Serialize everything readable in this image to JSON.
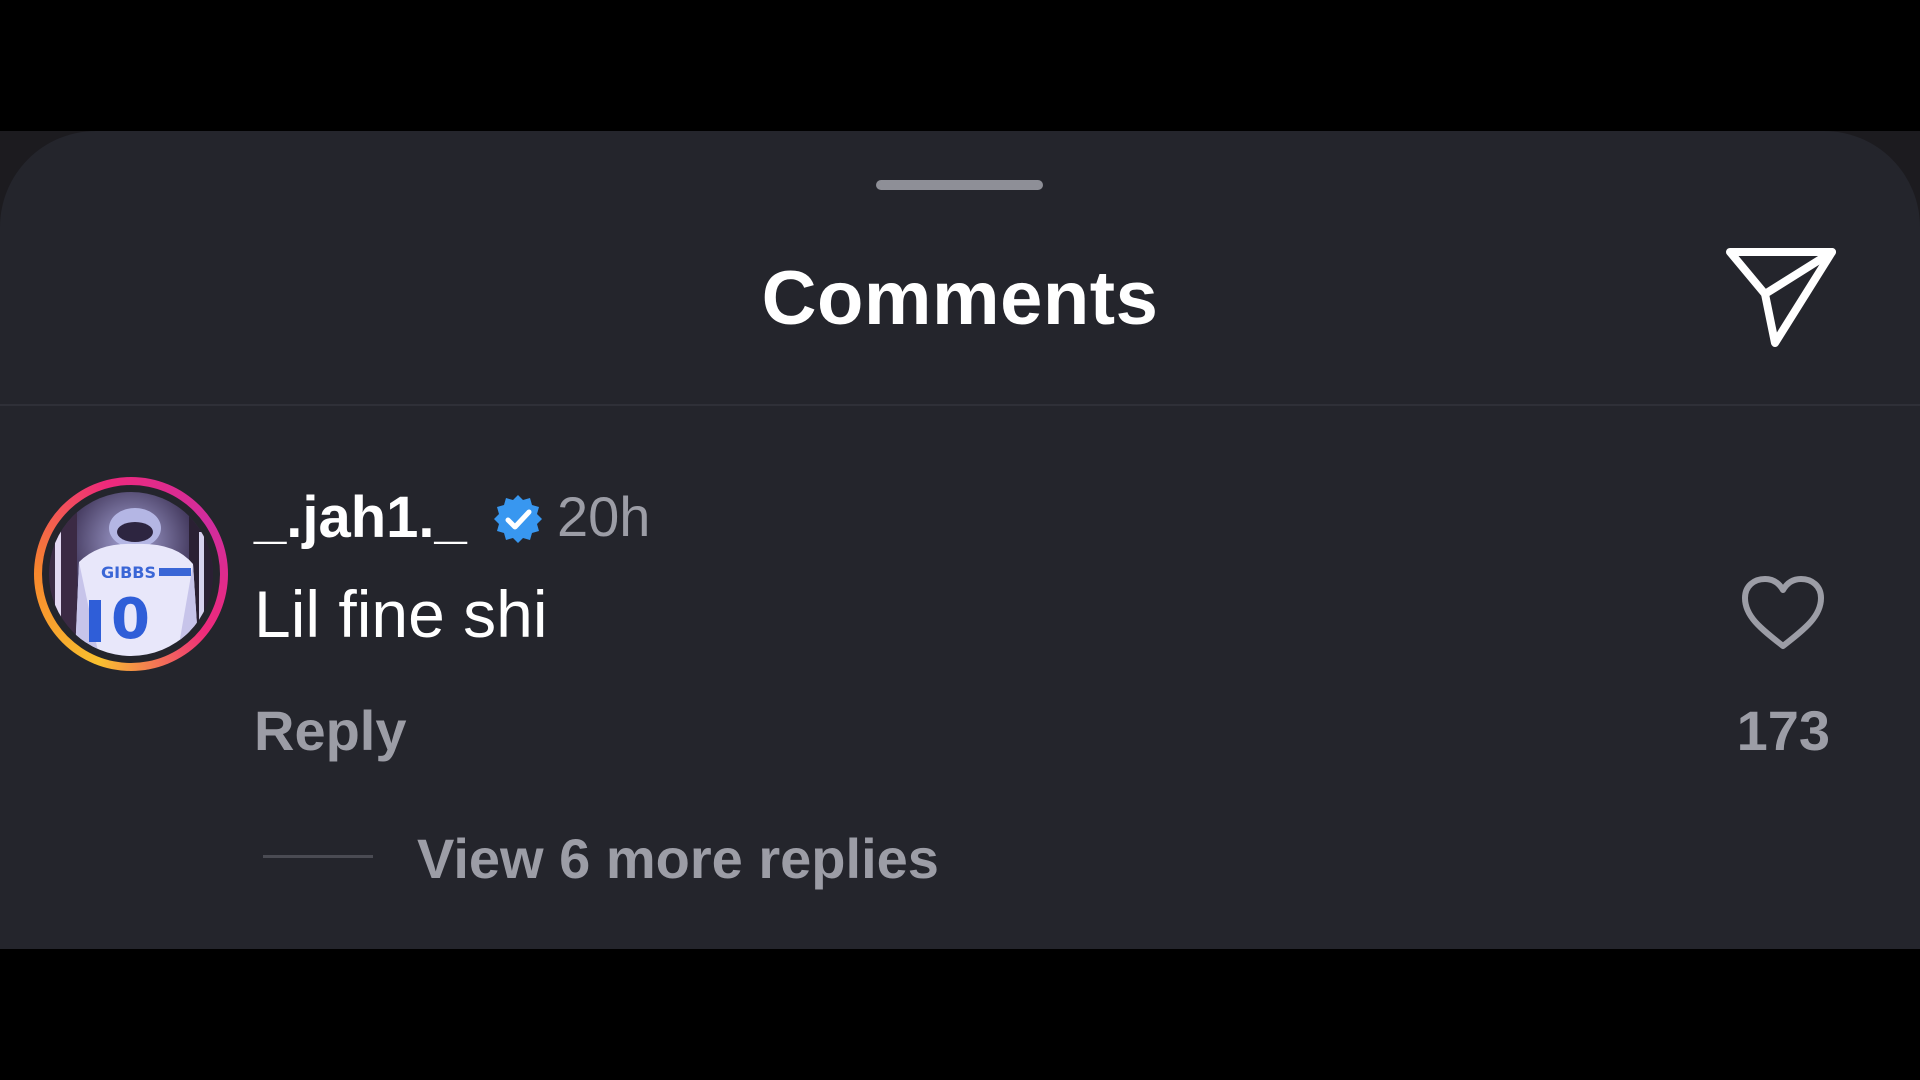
{
  "sheet": {
    "title": "Comments",
    "send_icon": "send-paper-plane-icon"
  },
  "comment": {
    "avatar_icon": "user-avatar-football-jersey",
    "username": "_.jah1._",
    "verified_icon": "verified-badge-icon",
    "time": "20h",
    "text": "Lil fine shi",
    "like_icon": "heart-outline-icon",
    "like_count": "173",
    "reply_label": "Reply",
    "view_replies_label": "View 6 more replies"
  },
  "colors": {
    "sheet_bg": "#24252c",
    "text_primary": "#ffffff",
    "text_secondary": "#9c9da6",
    "verified_blue": "#3897f0",
    "story_ring": [
      "#f9c02f",
      "#f7862d",
      "#ee2a7b",
      "#d02c9e"
    ]
  }
}
